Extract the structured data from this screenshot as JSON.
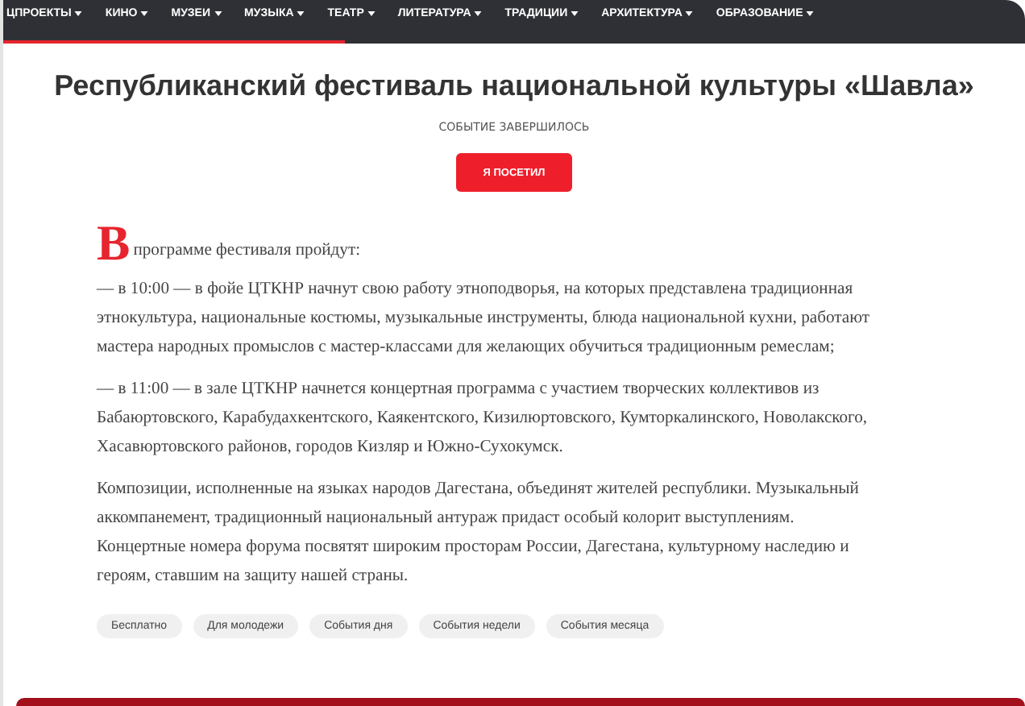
{
  "nav": {
    "items": [
      {
        "label": "ЦПРОЕКТЫ"
      },
      {
        "label": "КИНО"
      },
      {
        "label": "МУЗЕИ"
      },
      {
        "label": "МУЗЫКА"
      },
      {
        "label": "ТЕАТР"
      },
      {
        "label": "ЛИТЕРАТУРА"
      },
      {
        "label": "ТРАДИЦИИ"
      },
      {
        "label": "АРХИТЕКТУРА"
      },
      {
        "label": "ОБРАЗОВАНИЕ"
      }
    ],
    "progress": {
      "level": 0.335
    }
  },
  "event": {
    "title": "Республиканский фестиваль национальной культуры «Шавла»",
    "status": "СОБЫТИЕ ЗАВЕРШИЛОСЬ",
    "button": "Я ПОСЕТИЛ"
  },
  "article": {
    "drop_cap": "В",
    "intro": "программе фестиваля пройдут:",
    "paragraphs": [
      "— в 10:00 — в фойе ЦТКНР начнут свою работу этноподворья, на которых представлена традиционная этнокультура, национальные костюмы, музыкальные инструменты, блюда национальной кухни, работают мастера народных промыслов с мастер-классами для желающих обучиться традиционным ремеслам;",
      "— в 11:00 — в зале ЦТКНР начнется концертная программа с участием творческих коллективов из Бабаюртовского, Карабудахкентского, Каякентского, Кизилюртовского, Кумторкалинского, Новолакского, Хасавюртовского районов, городов Кизляр и Южно-Сухокумск.",
      "Композиции, исполненные на языках народов Дагестана, объединят жителей республики. Музыкальный аккомпанемент, традиционный национальный антураж придаст особый колорит выступлениям. Концертные номера форума посвятят широким просторам России, Дагестана, культурному наследию и героям, ставшим на защиту нашей страны."
    ]
  },
  "tags": [
    "Бесплатно",
    "Для молодежи",
    "События дня",
    "События недели",
    "События месяца"
  ]
}
